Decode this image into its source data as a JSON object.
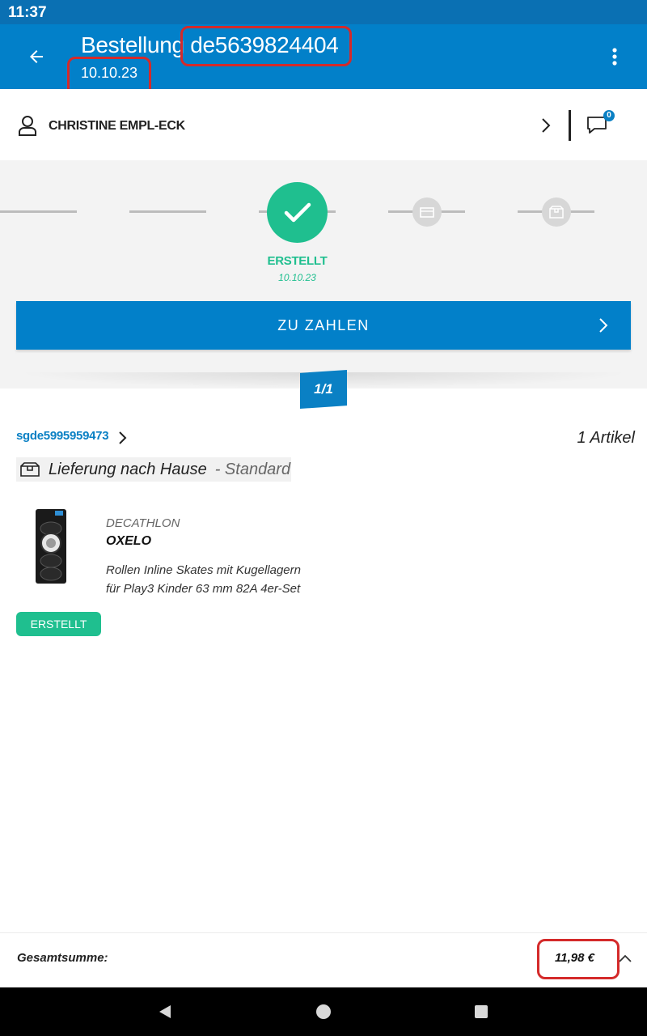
{
  "status_bar": {
    "time": "11:37"
  },
  "app_bar": {
    "title_prefix": "Bestellung",
    "order_number": "de5639824404",
    "order_date": "10.10.23"
  },
  "customer": {
    "name": "CHRISTINE EMPL-ECK",
    "message_count": "0"
  },
  "progress": {
    "current_step_label": "ERSTELLT",
    "current_step_date": "10.10.23"
  },
  "pay_button": {
    "label": "ZU ZAHLEN"
  },
  "pager": {
    "label": "1/1"
  },
  "shipment": {
    "id": "sgde5995959473",
    "article_count": "1 Artikel",
    "delivery_type": "Lieferung nach Hause",
    "delivery_mode": "- Standard"
  },
  "product": {
    "brand": "DECATHLON",
    "model": "OXELO",
    "description": "Rollen Inline Skates mit Kugellagern für Play3 Kinder 63 mm 82A 4er-Set",
    "status": "ERSTELLT"
  },
  "total": {
    "label": "Gesamtsumme:",
    "value": "11,98 €"
  },
  "colors": {
    "primary_blue": "#0280c9",
    "success_green": "#1fbf8f",
    "annotation_red": "#d42a2a"
  }
}
